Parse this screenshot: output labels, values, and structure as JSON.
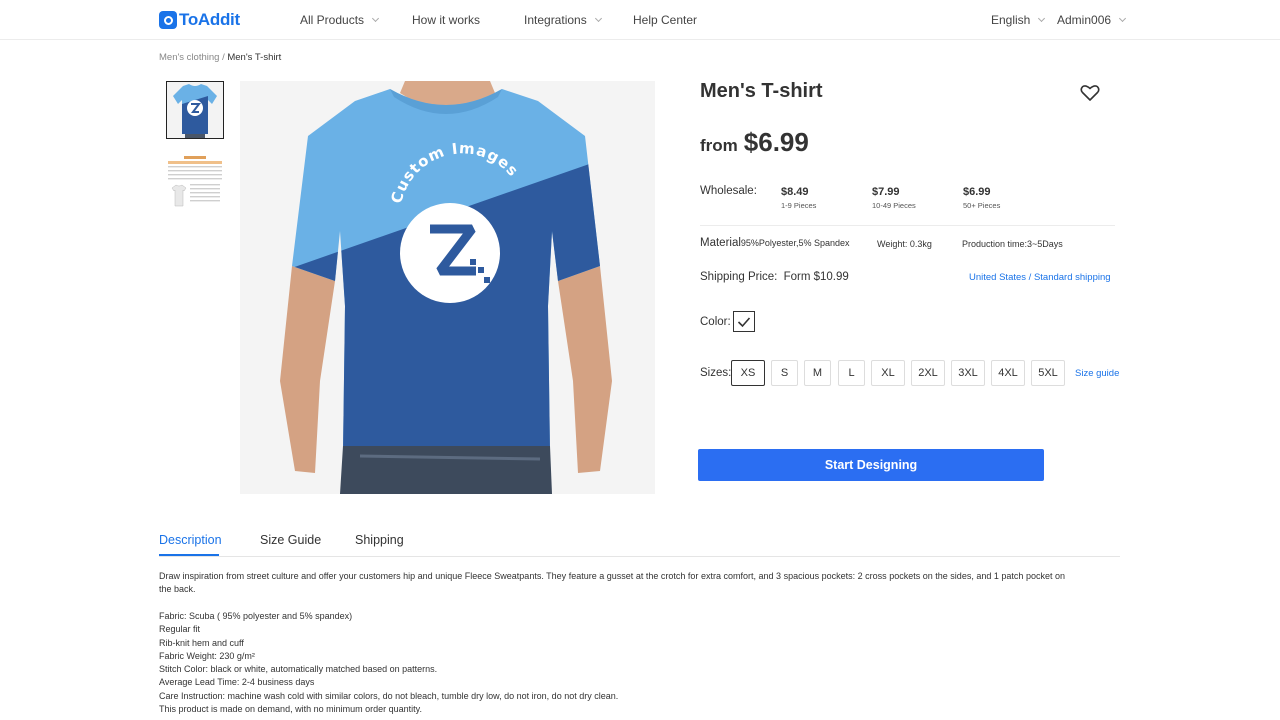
{
  "brand": {
    "name": "ToAddit",
    "color": "#1a73e8"
  },
  "nav": {
    "items": [
      {
        "label": "All Products",
        "dropdown": true
      },
      {
        "label": "How it works",
        "dropdown": false
      },
      {
        "label": "Integrations",
        "dropdown": true
      },
      {
        "label": "Help Center",
        "dropdown": false
      }
    ],
    "language": "English",
    "user": "Admin006"
  },
  "breadcrumb": {
    "parent": "Men's clothing",
    "separator": "/",
    "current": "Men's T-shirt"
  },
  "product": {
    "title": "Men's T-shirt",
    "price_from_label": "from",
    "price": "$6.99",
    "wholesale_label": "Wholesale:",
    "tiers": [
      {
        "price": "$8.49",
        "qty": "1-9 Pieces"
      },
      {
        "price": "$7.99",
        "qty": "10-49 Pieces"
      },
      {
        "price": "$6.99",
        "qty": "50+ Pieces"
      }
    ],
    "material_label": "Material",
    "material_value": "95%Polyester,5% Spandex",
    "weight": "Weight: 0.3kg",
    "production_time": "Production time:3~5Days",
    "shipping_label": "Shipping Price:",
    "shipping_value": "Form $10.99",
    "shipping_region": "United States / Standard shipping",
    "color_label": "Color:",
    "sizes_label": "Sizes:",
    "sizes": [
      "XS",
      "S",
      "M",
      "L",
      "XL",
      "2XL",
      "3XL",
      "4XL",
      "5XL"
    ],
    "selected_size": "XS",
    "size_guide": "Size guide",
    "cta": "Start Designing",
    "image_text": "Custom Images"
  },
  "tabs": [
    "Description",
    "Size Guide",
    "Shipping"
  ],
  "active_tab": "Description",
  "description": {
    "intro": "Draw inspiration from street culture and offer your customers hip and unique Fleece Sweatpants. They feature a gusset at the crotch for extra comfort, and 3 spacious pockets: 2 cross pockets on the sides, and 1 patch pocket on the back.",
    "lines": [
      "Fabric: Scuba ( 95% polyester and 5% spandex)",
      "Regular fit",
      "Rib-knit hem and cuff",
      "Fabric Weight: 230 g/m²",
      "Stitch Color: black or white, automatically matched based on patterns.",
      "Average Lead Time: 2-4 business days",
      "Care Instruction: machine wash cold with similar colors, do not bleach, tumble dry low, do not iron, do not dry clean.",
      "This product is made on demand, with no minimum order quantity."
    ]
  },
  "colors": {
    "accent": "#1a73e8",
    "button": "#2b6ef2",
    "shirt_light": "#6ab1e6",
    "shirt_dark": "#2e5a9e"
  }
}
